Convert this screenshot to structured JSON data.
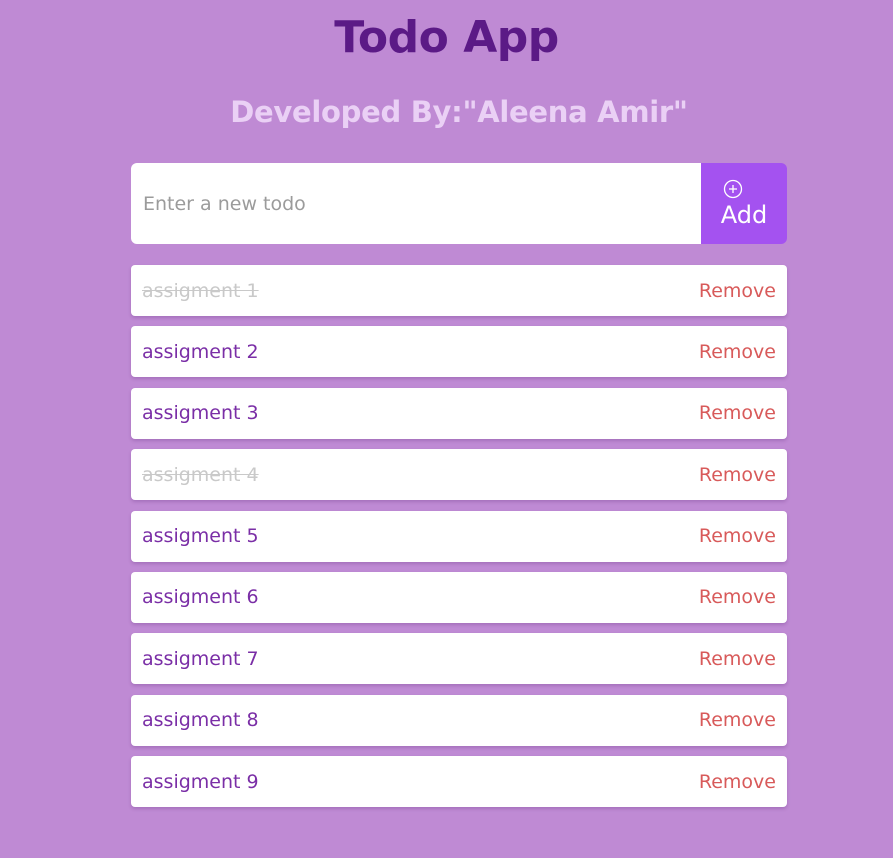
{
  "header": {
    "title": "Todo App",
    "subtitle": "Developed By:\"Aleena Amir\""
  },
  "form": {
    "placeholder": "Enter a new todo",
    "value": "",
    "add_label": "Add",
    "add_icon": "plus-circle-icon"
  },
  "todos": [
    {
      "text": "assigment 1",
      "completed": true,
      "remove_label": "Remove"
    },
    {
      "text": "assigment 2",
      "completed": false,
      "remove_label": "Remove"
    },
    {
      "text": "assigment 3",
      "completed": false,
      "remove_label": "Remove"
    },
    {
      "text": "assigment 4",
      "completed": true,
      "remove_label": "Remove"
    },
    {
      "text": "assigment 5",
      "completed": false,
      "remove_label": "Remove"
    },
    {
      "text": "assigment 6",
      "completed": false,
      "remove_label": "Remove"
    },
    {
      "text": "assigment 7",
      "completed": false,
      "remove_label": "Remove"
    },
    {
      "text": "assigment 8",
      "completed": false,
      "remove_label": "Remove"
    },
    {
      "text": "assigment 9",
      "completed": false,
      "remove_label": "Remove"
    }
  ],
  "colors": {
    "background": "#bf8ad4",
    "title": "#5b1a86",
    "subtitle": "#ead0f5",
    "accent": "#a452f0",
    "todo_text": "#7a2ea6",
    "completed_text": "#c9c9c9",
    "remove": "#d85a5a"
  }
}
